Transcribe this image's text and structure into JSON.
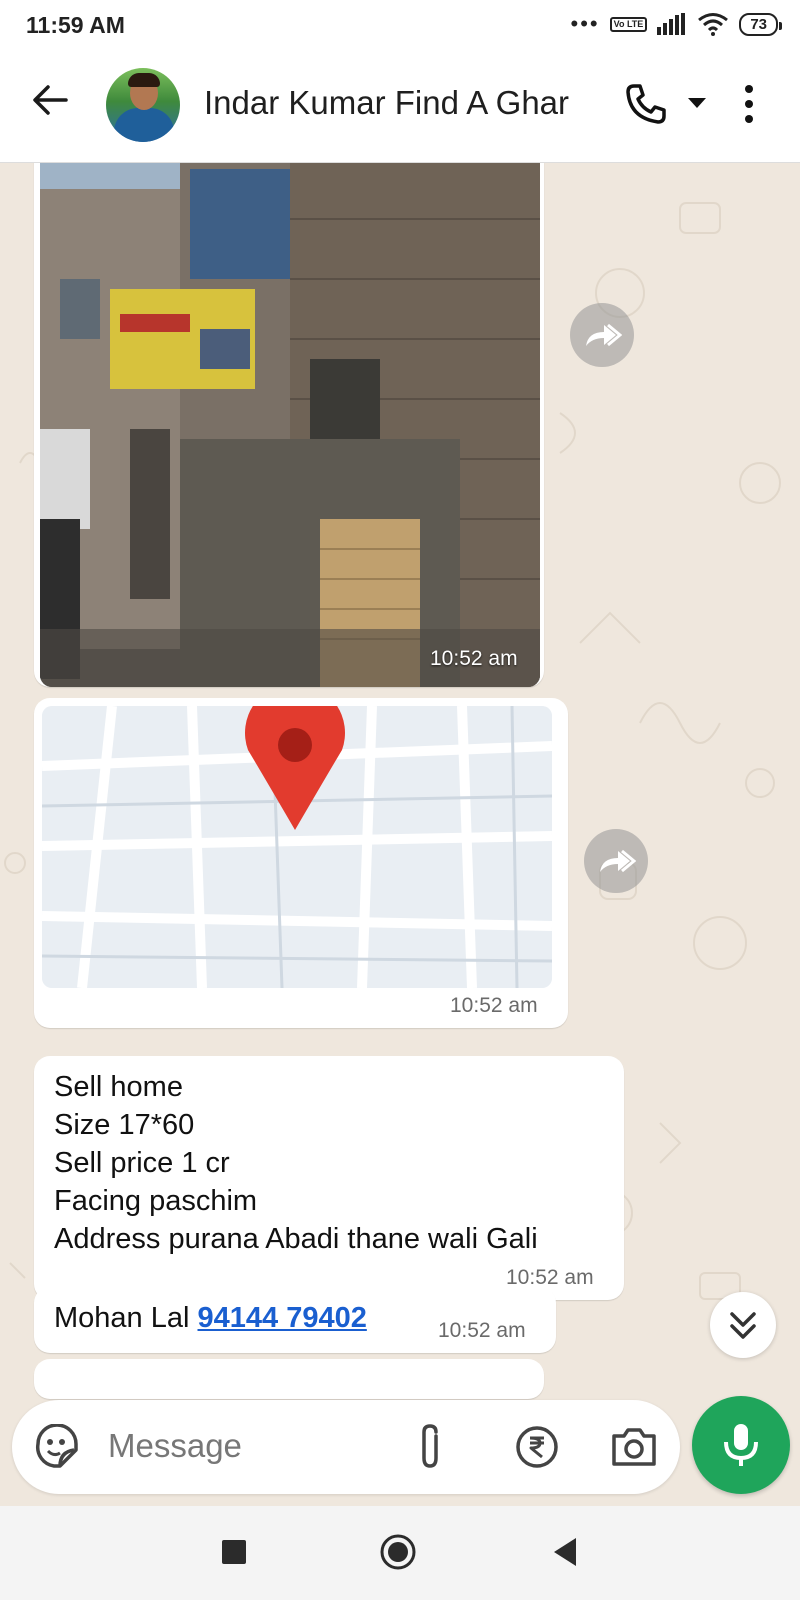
{
  "status_bar": {
    "time": "11:59 AM",
    "signal_dots": "•••",
    "volte": "Vo LTE",
    "battery": "73"
  },
  "header": {
    "contact_name": "Indar Kumar Find A Ghar"
  },
  "messages": [
    {
      "type": "image",
      "time": "10:52 am"
    },
    {
      "type": "location",
      "time": "10:52 am"
    },
    {
      "type": "text",
      "lines": [
        "Sell home",
        "Size 17*60",
        "Sell price 1 cr",
        "Facing paschim",
        "Address purana Abadi thane  wali Gali"
      ],
      "time": "10:52 am"
    },
    {
      "type": "text",
      "prefix": "Mohan Lal ",
      "phone": "94144 79402",
      "time": "10:52 am"
    }
  ],
  "input": {
    "placeholder": "Message"
  },
  "colors": {
    "accent_green": "#1fa55b",
    "chat_background": "#efe7dd",
    "link_blue": "#1a5fd0"
  },
  "icons": [
    "back-arrow-icon",
    "phone-icon",
    "dropdown-caret-icon",
    "more-vert-icon",
    "forward-icon",
    "chevrons-down-icon",
    "sticker-icon",
    "paperclip-icon",
    "rupee-icon",
    "camera-icon",
    "mic-icon",
    "nav-square-icon",
    "nav-home-icon",
    "nav-back-icon"
  ]
}
